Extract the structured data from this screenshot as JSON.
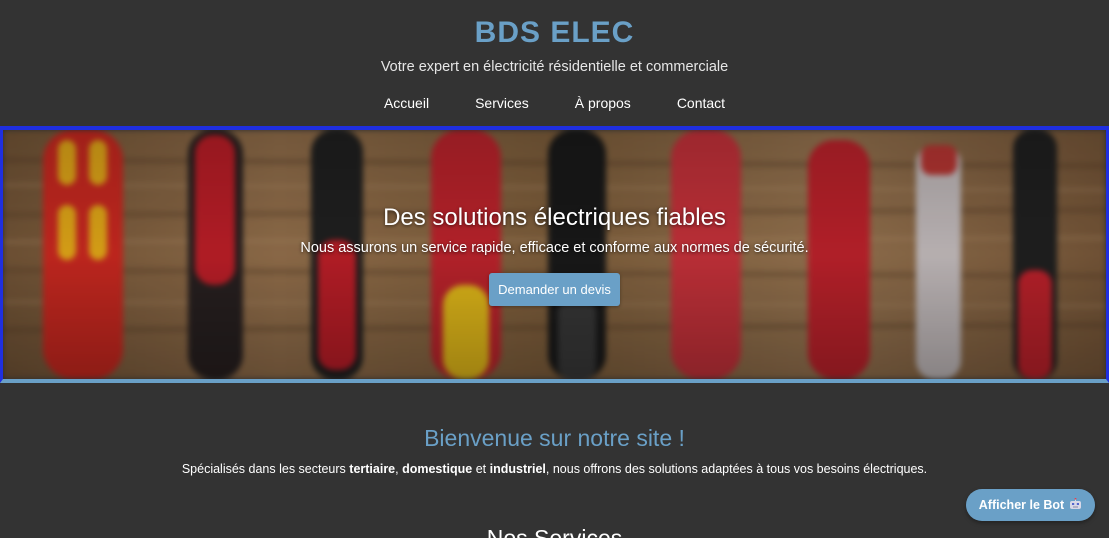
{
  "colors": {
    "background": "#333333",
    "accent": "#6aa0c7",
    "hero_border_top": "#1f2fe0",
    "hero_border_bottom": "#6aa0c7"
  },
  "header": {
    "title": "BDS ELEC",
    "tagline": "Votre expert en électricité résidentielle et commerciale"
  },
  "nav": {
    "items": [
      {
        "label": "Accueil"
      },
      {
        "label": "Services"
      },
      {
        "label": "À propos"
      },
      {
        "label": "Contact"
      }
    ]
  },
  "hero": {
    "title": "Des solutions électriques fiables",
    "subtitle": "Nous assurons un service rapide, efficace et conforme aux normes de sécurité.",
    "button_label": "Demander un devis",
    "background_image": "blurred-screwdrivers-photo"
  },
  "welcome": {
    "title": "Bienvenue sur notre site !",
    "text_before": "Spécialisés dans les secteurs ",
    "sector_1": "tertiaire",
    "sep_1": ", ",
    "sector_2": "domestique",
    "sep_2": " et ",
    "sector_3": "industriel",
    "text_after": ", nous offrons des solutions adaptées à tous vos besoins électriques."
  },
  "services": {
    "title": "Nos Services"
  },
  "bot": {
    "label": "Afficher le Bot",
    "icon": "robot-icon"
  }
}
